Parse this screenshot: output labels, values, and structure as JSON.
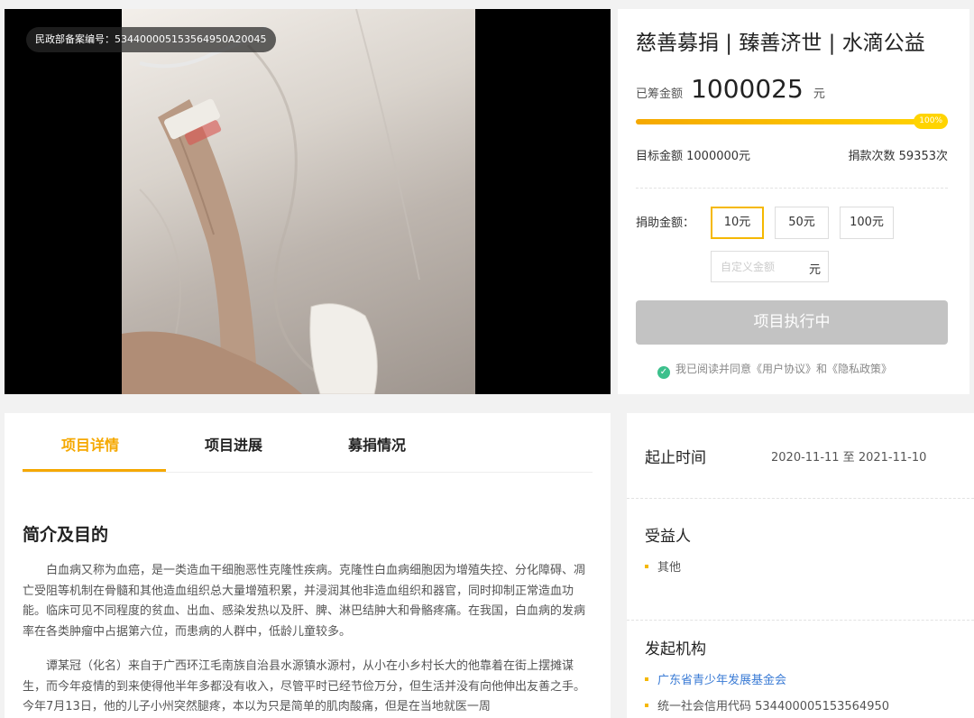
{
  "hero": {
    "record_badge": "民政部备案编号：534400005153564950A20045"
  },
  "project": {
    "title": "慈善募捐 | 臻善济世 | 水滴公益",
    "raised_label": "已筹金额",
    "raised_amount": "1000025",
    "raised_unit": "元",
    "progress_percent": 100,
    "progress_label": "100%",
    "goal_text": "目标金额 1000000元",
    "count_text": "捐款次数 59353次",
    "donate_label": "捐助金额：",
    "amount_options": [
      "10元",
      "50元",
      "100元"
    ],
    "selected_amount": "10元",
    "custom_placeholder": "自定义金额",
    "custom_unit": "元",
    "exec_button": "项目执行中",
    "agree_text": "我已阅读并同意《用户协议》和《隐私政策》"
  },
  "tabs": [
    "项目详情",
    "项目进展",
    "募捐情况"
  ],
  "article": {
    "section_title": "简介及目的",
    "para1": "白血病又称为血癌，是一类造血干细胞恶性克隆性疾病。克隆性白血病细胞因为增殖失控、分化障碍、凋亡受阻等机制在骨髓和其他造血组织总大量增殖积累，并浸润其他非造血组织和器官，同时抑制正常造血功能。临床可见不同程度的贫血、出血、感染发热以及肝、脾、淋巴结肿大和骨骼疼痛。在我国，白血病的发病率在各类肿瘤中占据第六位，而患病的人群中，低龄儿童较多。",
    "para2": "谭某冠（化名）来自于广西环江毛南族自治县水源镇水源村，从小在小乡村长大的他靠着在街上摆摊谋生，而今年疫情的到来使得他半年多都没有收入，尽管平时已经节俭万分，但生活并没有向他伸出友善之手。今年7月13日，他的儿子小州突然腿疼，本以为只是简单的肌肉酸痛，但是在当地就医一周"
  },
  "sidebar": {
    "period_label": "起止时间",
    "period_value": "2020-11-11 至 2021-11-10",
    "beneficiary_label": "受益人",
    "beneficiary_value": "其他",
    "organizer_label": "发起机构",
    "organizer_name": "广东省青少年发展基金会",
    "organizer_code": "统一社会信用代码 534400005153564950"
  },
  "colors": {
    "accent": "#f5a800",
    "link": "#3a7bd5",
    "check": "#3cc08c",
    "disabled_button": "#c3c3c3"
  }
}
